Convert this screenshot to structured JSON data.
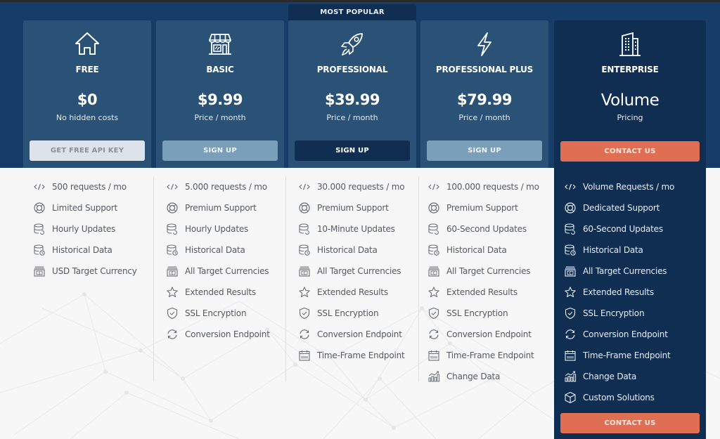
{
  "popular_tag": "MOST POPULAR",
  "colors": {
    "header_bg": "#153d67",
    "card_bg": "#2a5276",
    "highlight_bg": "#0f2e52",
    "accent_orange": "#e06e52",
    "steel_button": "#7a9fba",
    "light_button": "#dde3ea"
  },
  "plans": [
    {
      "icon": "house-icon",
      "name": "FREE",
      "price": "$0",
      "subtext": "No hidden costs",
      "button": "GET FREE API KEY",
      "features": [
        {
          "icon": "code-icon",
          "label": "500 requests / mo"
        },
        {
          "icon": "lifebuoy-icon",
          "label": "Limited Support"
        },
        {
          "icon": "database-refresh-icon",
          "label": "Hourly Updates"
        },
        {
          "icon": "database-clock-icon",
          "label": "Historical Data"
        },
        {
          "icon": "currency-dollar-icon",
          "label": "USD Target Currency"
        }
      ]
    },
    {
      "icon": "storefront-icon",
      "name": "BASIC",
      "price": "$9.99",
      "subtext": "Price / month",
      "button": "SIGN UP",
      "features": [
        {
          "icon": "code-icon",
          "label": "5.000 requests / mo"
        },
        {
          "icon": "lifebuoy-icon",
          "label": "Premium Support"
        },
        {
          "icon": "database-refresh-icon",
          "label": "Hourly Updates"
        },
        {
          "icon": "database-clock-icon",
          "label": "Historical Data"
        },
        {
          "icon": "currency-euro-icon",
          "label": "All Target Currencies"
        },
        {
          "icon": "star-icon",
          "label": "Extended Results"
        },
        {
          "icon": "shield-check-icon",
          "label": "SSL Encryption"
        },
        {
          "icon": "sync-icon",
          "label": "Conversion Endpoint"
        }
      ]
    },
    {
      "icon": "rocket-icon",
      "name": "PROFESSIONAL",
      "price": "$39.99",
      "subtext": "Price / month",
      "button": "SIGN UP",
      "features": [
        {
          "icon": "code-icon",
          "label": "30.000 requests / mo"
        },
        {
          "icon": "lifebuoy-icon",
          "label": "Premium Support"
        },
        {
          "icon": "database-refresh-icon",
          "label": "10-Minute Updates"
        },
        {
          "icon": "database-clock-icon",
          "label": "Historical Data"
        },
        {
          "icon": "currency-euro-icon",
          "label": "All Target Currencies"
        },
        {
          "icon": "star-icon",
          "label": "Extended Results"
        },
        {
          "icon": "shield-check-icon",
          "label": "SSL Encryption"
        },
        {
          "icon": "sync-icon",
          "label": "Conversion Endpoint"
        },
        {
          "icon": "calendar-icon",
          "label": "Time-Frame Endpoint"
        }
      ]
    },
    {
      "icon": "lightning-icon",
      "name": "PROFESSIONAL PLUS",
      "price": "$79.99",
      "subtext": "Price / month",
      "button": "SIGN UP",
      "features": [
        {
          "icon": "code-icon",
          "label": "100.000 requests / mo"
        },
        {
          "icon": "lifebuoy-icon",
          "label": "Premium Support"
        },
        {
          "icon": "database-refresh-icon",
          "label": "60-Second Updates"
        },
        {
          "icon": "database-clock-icon",
          "label": "Historical Data"
        },
        {
          "icon": "currency-euro-icon",
          "label": "All Target Currencies"
        },
        {
          "icon": "star-icon",
          "label": "Extended Results"
        },
        {
          "icon": "shield-check-icon",
          "label": "SSL Encryption"
        },
        {
          "icon": "sync-icon",
          "label": "Conversion Endpoint"
        },
        {
          "icon": "calendar-icon",
          "label": "Time-Frame Endpoint"
        },
        {
          "icon": "chart-growth-icon",
          "label": "Change Data"
        }
      ]
    },
    {
      "icon": "building-icon",
      "name": "ENTERPRISE",
      "price": "Volume",
      "subtext": "Pricing",
      "button": "CONTACT US",
      "bottom_button": "CONTACT US",
      "features": [
        {
          "icon": "code-icon",
          "label": "Volume Requests / mo"
        },
        {
          "icon": "lifebuoy-icon",
          "label": "Dedicated Support"
        },
        {
          "icon": "database-refresh-icon",
          "label": "60-Second Updates"
        },
        {
          "icon": "database-clock-icon",
          "label": "Historical Data"
        },
        {
          "icon": "currency-euro-icon",
          "label": "All Target Currencies"
        },
        {
          "icon": "star-icon",
          "label": "Extended Results"
        },
        {
          "icon": "shield-check-icon",
          "label": "SSL Encryption"
        },
        {
          "icon": "sync-icon",
          "label": "Conversion Endpoint"
        },
        {
          "icon": "calendar-icon",
          "label": "Time-Frame Endpoint"
        },
        {
          "icon": "chart-growth-icon",
          "label": "Change Data"
        },
        {
          "icon": "cube-icon",
          "label": "Custom Solutions"
        }
      ]
    }
  ]
}
